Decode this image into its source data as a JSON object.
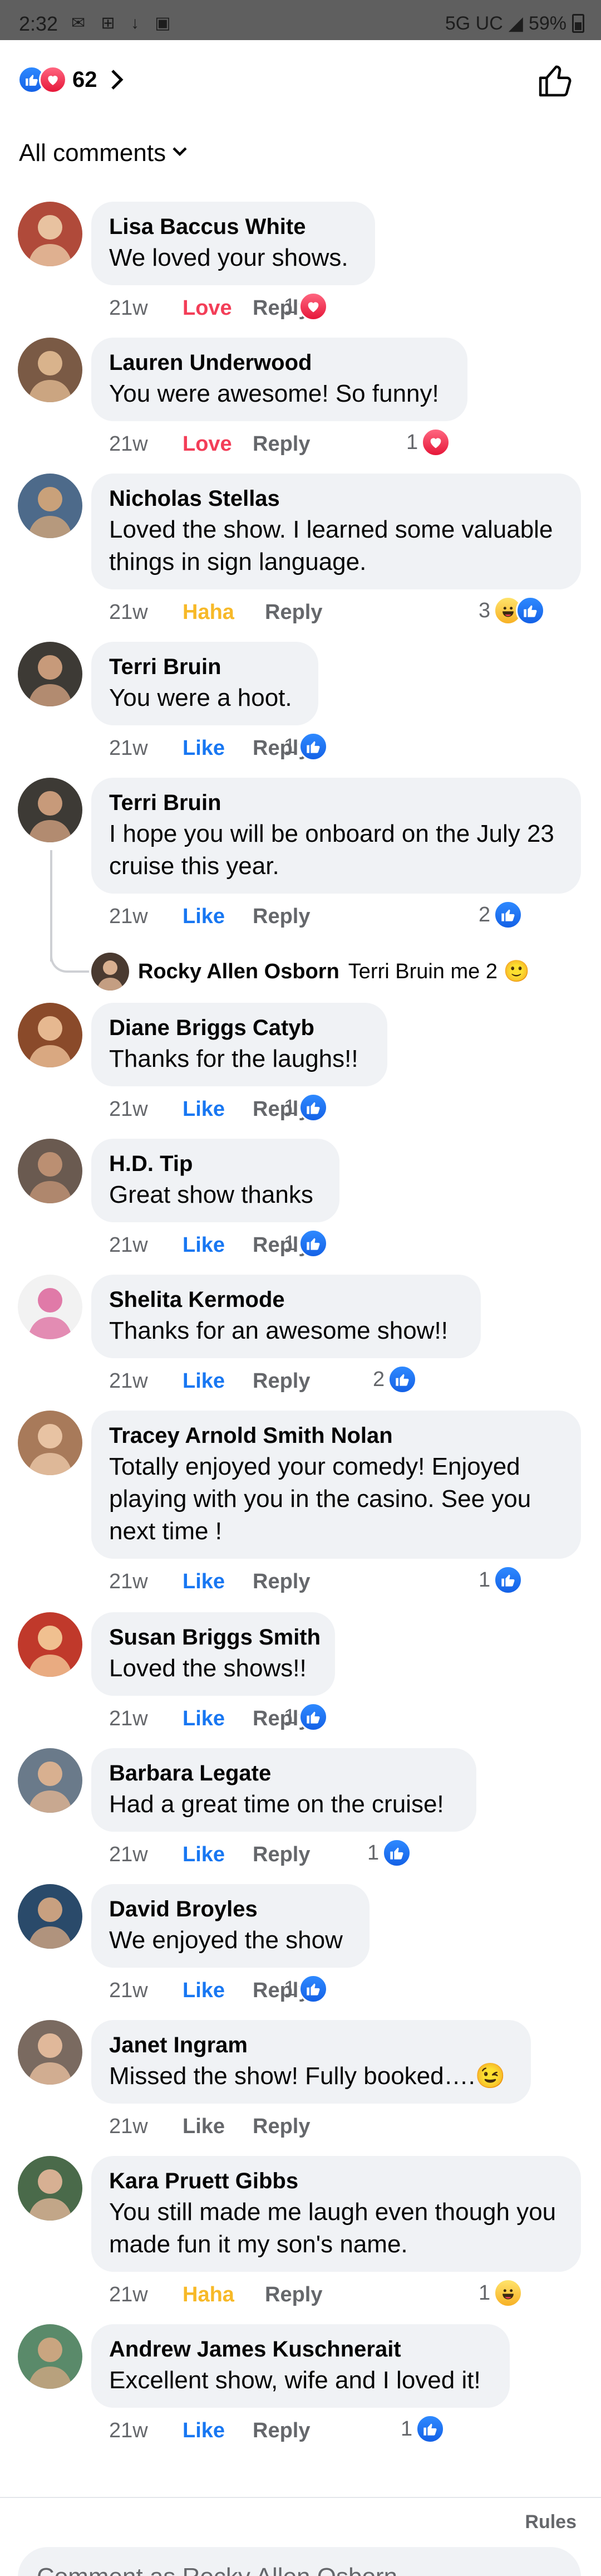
{
  "status_bar": {
    "time": "2:32",
    "network": "5G UC",
    "battery": "59%"
  },
  "header": {
    "reaction_count": "62",
    "reaction_icons": [
      "like-icon",
      "love-icon"
    ]
  },
  "filter": {
    "label": "All comments"
  },
  "comments": [
    {
      "author": "Lisa Baccus White",
      "text": "We loved your shows.",
      "age": "21w",
      "reaction": "Love",
      "reply": "Reply",
      "count": "1",
      "count_icons": [
        "love"
      ]
    },
    {
      "author": "Lauren Underwood",
      "text": "You were awesome! So funny!",
      "age": "21w",
      "reaction": "Love",
      "reply": "Reply",
      "count": "1",
      "count_icons": [
        "love"
      ]
    },
    {
      "author": "Nicholas Stellas",
      "text": "Loved the show. I learned some valuable things in sign language.",
      "age": "21w",
      "reaction": "Haha",
      "reply": "Reply",
      "count": "3",
      "count_icons": [
        "haha",
        "like"
      ]
    },
    {
      "author": "Terri Bruin",
      "text": "You were a hoot.",
      "age": "21w",
      "reaction": "Like",
      "reply": "Reply",
      "count": "1",
      "count_icons": [
        "like"
      ]
    },
    {
      "author": "Terri Bruin",
      "text": "I hope you will be onboard on the July 23 cruise this year.",
      "age": "21w",
      "reaction": "Like",
      "reply": "Reply",
      "count": "2",
      "count_icons": [
        "like"
      ]
    },
    {
      "author": "Diane Briggs Catyb",
      "text": "Thanks for the laughs!!",
      "age": "21w",
      "reaction": "Like",
      "reply": "Reply",
      "count": "1",
      "count_icons": [
        "like"
      ]
    },
    {
      "author": "H.D. Tip",
      "text": "Great show thanks",
      "age": "21w",
      "reaction": "Like",
      "reply": "Reply",
      "count": "1",
      "count_icons": [
        "like"
      ]
    },
    {
      "author": "Shelita Kermode",
      "text": "Thanks for an awesome show!!",
      "age": "21w",
      "reaction": "Like",
      "reply": "Reply",
      "count": "2",
      "count_icons": [
        "like"
      ]
    },
    {
      "author": "Tracey Arnold Smith Nolan",
      "text": "Totally enjoyed your comedy!  Enjoyed playing with you in the casino. See you next time !",
      "age": "21w",
      "reaction": "Like",
      "reply": "Reply",
      "count": "1",
      "count_icons": [
        "like"
      ]
    },
    {
      "author": "Susan Briggs Smith",
      "text": "Loved the shows!!",
      "age": "21w",
      "reaction": "Like",
      "reply": "Reply",
      "count": "1",
      "count_icons": [
        "like"
      ]
    },
    {
      "author": "Barbara Legate",
      "text": "Had a great time on the cruise!",
      "age": "21w",
      "reaction": "Like",
      "reply": "Reply",
      "count": "1",
      "count_icons": [
        "like"
      ]
    },
    {
      "author": "David Broyles",
      "text": "We enjoyed the show",
      "age": "21w",
      "reaction": "Like",
      "reply": "Reply",
      "count": "1",
      "count_icons": [
        "like"
      ]
    },
    {
      "author": "Janet Ingram",
      "text": "Missed the show! Fully booked….😉",
      "age": "21w",
      "reaction": "Like",
      "reply": "Reply",
      "count": "",
      "count_icons": []
    },
    {
      "author": "Kara Pruett Gibbs",
      "text": "You still made me laugh even though you made fun it my son's name.",
      "age": "21w",
      "reaction": "Haha",
      "reply": "Reply",
      "count": "1",
      "count_icons": [
        "haha"
      ]
    },
    {
      "author": "Andrew James Kuschnerait",
      "text": "Excellent show, wife and I loved it!",
      "age": "21w",
      "reaction": "Like",
      "reply": "Reply",
      "count": "1",
      "count_icons": [
        "like"
      ]
    }
  ],
  "reply": {
    "author": "Rocky Allen Osborn",
    "text": "Terri Bruin me 2 🙂"
  },
  "footer": {
    "rules_label": "Rules",
    "input_placeholder": "Comment as Rocky Allen Osborn"
  },
  "colors": {
    "like": "#1877f2",
    "love": "#f33e58",
    "haha": "#f7b928",
    "bubble": "#f0f2f5",
    "muted": "#65676b"
  }
}
